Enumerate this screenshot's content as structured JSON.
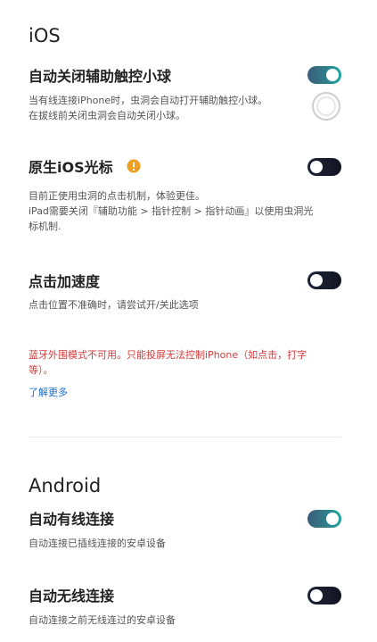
{
  "ios": {
    "section_title": "iOS",
    "assistive_touch": {
      "title": "自动关闭辅助触控小球",
      "desc_line1": "当有线连接iPhone时，虫洞会自动打开辅助触控小球。",
      "desc_line2": "在拔线前关闭虫洞会自动关闭小球。",
      "toggle": "on"
    },
    "native_cursor": {
      "title": "原生iOS光标",
      "desc_line1": "目前正使用虫洞的点击机制，体验更佳。",
      "desc_line2": "iPad需要关闭『辅助功能 > 指针控制 > 指针动画』以使用虫洞光",
      "desc_line3": "标机制.",
      "toggle": "off"
    },
    "click_accel": {
      "title": "点击加速度",
      "desc": "点击位置不准确时，请尝试开/关此选项",
      "toggle": "off"
    },
    "error": {
      "line1": "蓝牙外围模式不可用。只能投屏无法控制iPhone（如点击，打字",
      "line2": "等）。"
    },
    "learn_more": "了解更多"
  },
  "android": {
    "section_title": "Android",
    "wired": {
      "title": "自动有线连接",
      "desc": "自动连接已插线连接的安卓设备",
      "toggle": "on"
    },
    "wireless": {
      "title": "自动无线连接",
      "desc": "自动连接之前无线连过的安卓设备",
      "toggle": "off"
    }
  },
  "colors": {
    "toggle_on_gradient": [
      "#3c5c7a",
      "#1fa7a0"
    ],
    "toggle_off": "#181c2c",
    "error_text": "#d23c3c",
    "link": "#1a6fc9",
    "warning": "#f0a020"
  },
  "icons": {
    "warning": "warning-icon",
    "assist_ball": "assistive-touch-icon"
  }
}
